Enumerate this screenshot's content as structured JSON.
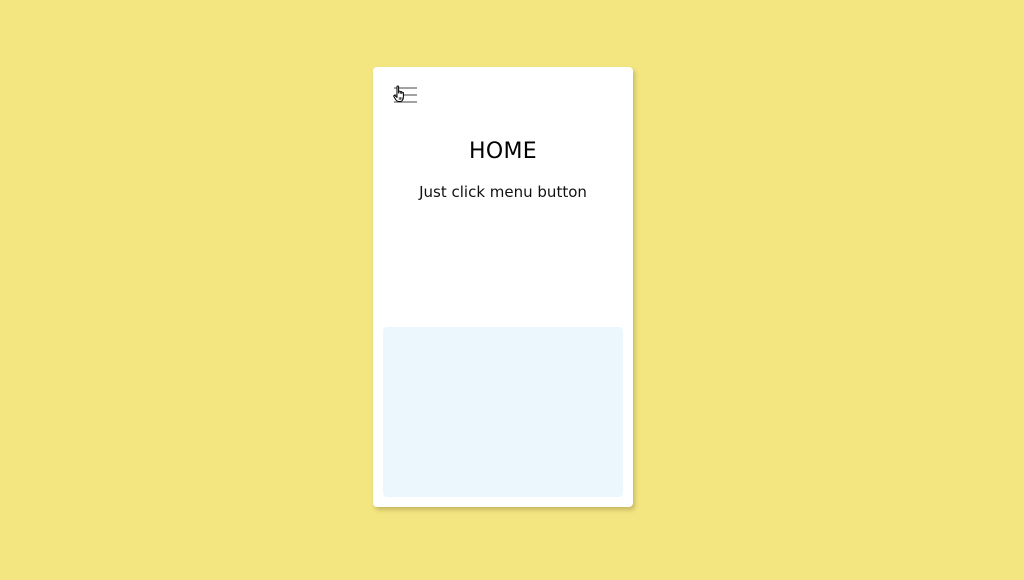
{
  "page": {
    "background_color": "#f3e681",
    "card_color": "#ffffff",
    "panel_color": "#ecf7fd"
  },
  "header": {
    "menu_icon": "hamburger-menu-icon",
    "cursor_icon": "hand-pointer-icon"
  },
  "main": {
    "title": "HOME",
    "subtitle": "Just click menu button"
  }
}
